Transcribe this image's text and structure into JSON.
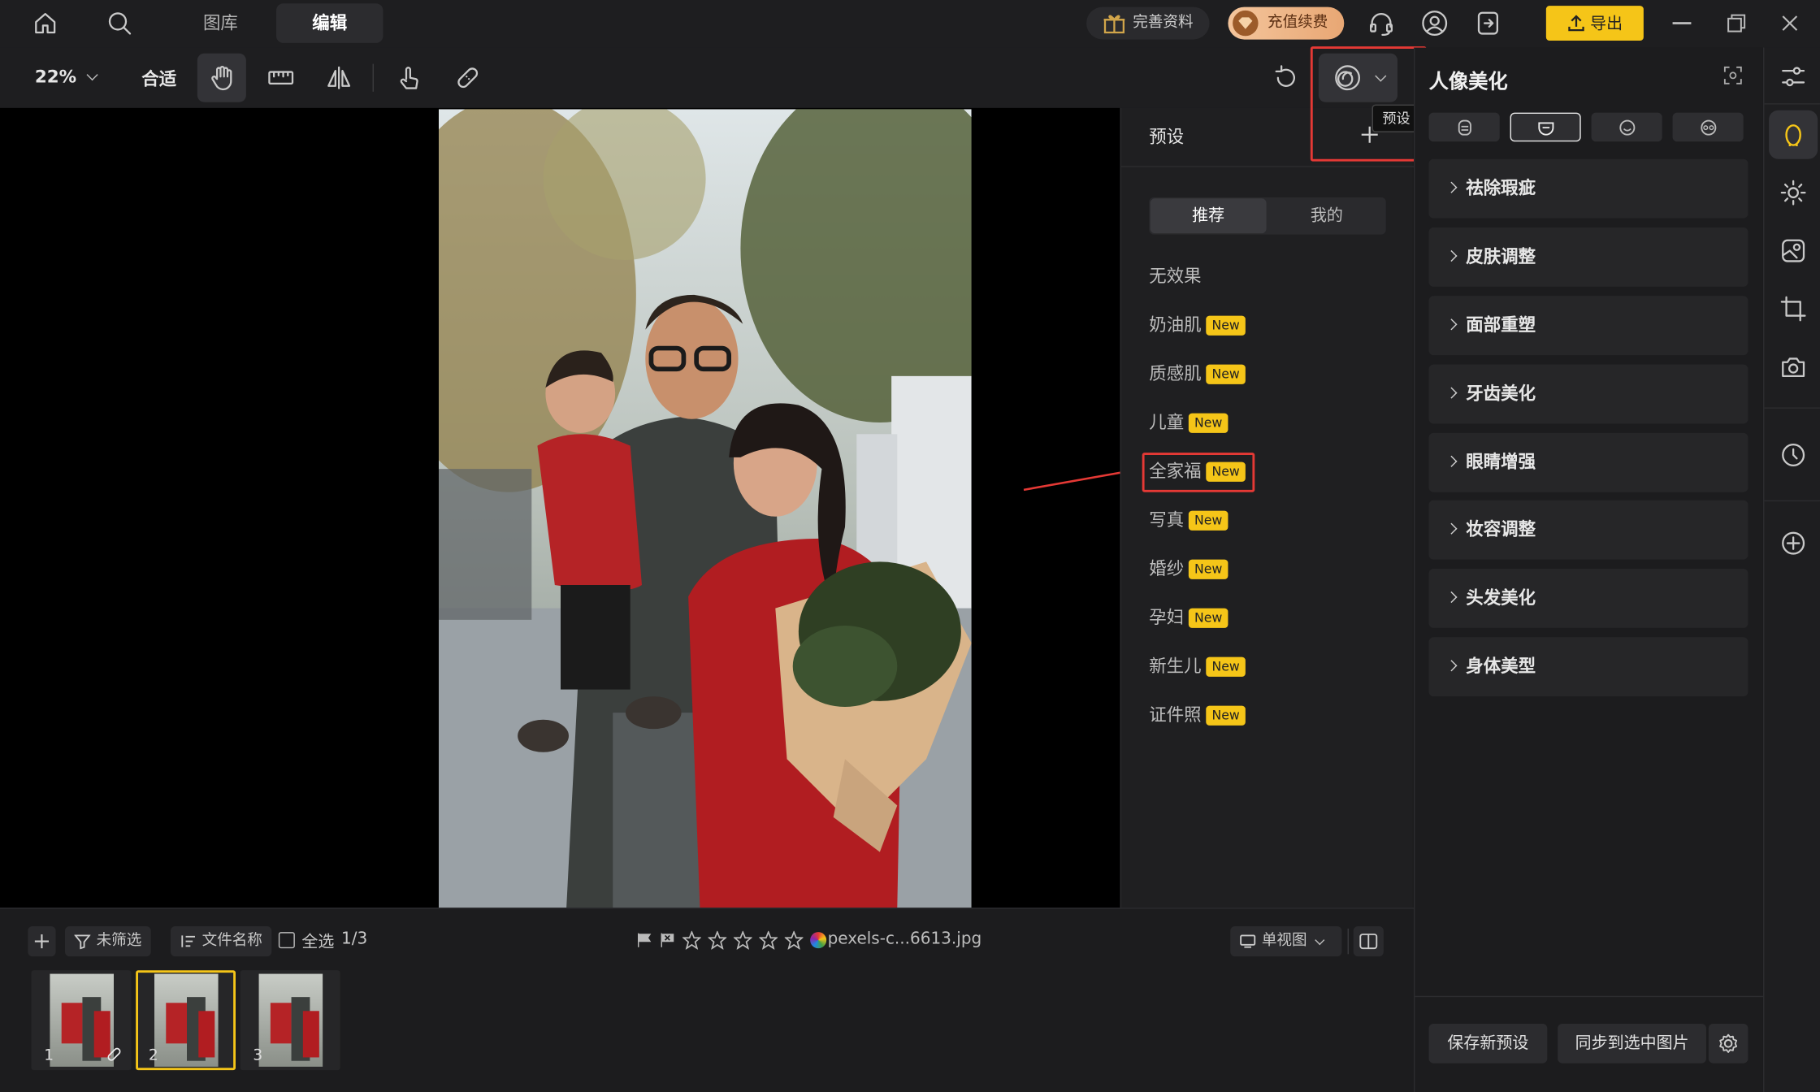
{
  "topbar": {
    "tabs": [
      "图库",
      "编辑"
    ],
    "active_tab": "编辑",
    "profile_btn": "完善资料",
    "vip_btn": "充值续费",
    "export_btn": "导出"
  },
  "toolbar": {
    "zoom": "22%",
    "fit": "合适",
    "tooltip": "预设"
  },
  "preset_panel": {
    "title": "预设",
    "tabs": [
      "推荐",
      "我的"
    ],
    "active_tab": "推荐",
    "items": [
      {
        "label": "无效果",
        "badge": ""
      },
      {
        "label": "奶油肌",
        "badge": "New"
      },
      {
        "label": "质感肌",
        "badge": "New"
      },
      {
        "label": "儿童",
        "badge": "New"
      },
      {
        "label": "全家福",
        "badge": "New",
        "highlighted": true
      },
      {
        "label": "写真",
        "badge": "New"
      },
      {
        "label": "婚纱",
        "badge": "New"
      },
      {
        "label": "孕妇",
        "badge": "New"
      },
      {
        "label": "新生儿",
        "badge": "New"
      },
      {
        "label": "证件照",
        "badge": "New"
      }
    ]
  },
  "right_panel": {
    "title": "人像美化",
    "sections": [
      "祛除瑕疵",
      "皮肤调整",
      "面部重塑",
      "牙齿美化",
      "眼睛增强",
      "妆容调整",
      "头发美化",
      "身体美型"
    ],
    "save_btn": "保存新预设",
    "sync_btn": "同步到选中图片"
  },
  "bottom": {
    "filter": "未筛选",
    "sort": "文件名称",
    "select_all": "全选",
    "count": "1/3",
    "filename": "pexels-c...6613.jpg",
    "view_mode": "单视图",
    "thumbs": [
      "1",
      "2",
      "3"
    ],
    "active_thumb": "2"
  },
  "colors": {
    "accent": "#f5c518",
    "highlight": "#e53935",
    "bg": "#1c1c1e"
  }
}
